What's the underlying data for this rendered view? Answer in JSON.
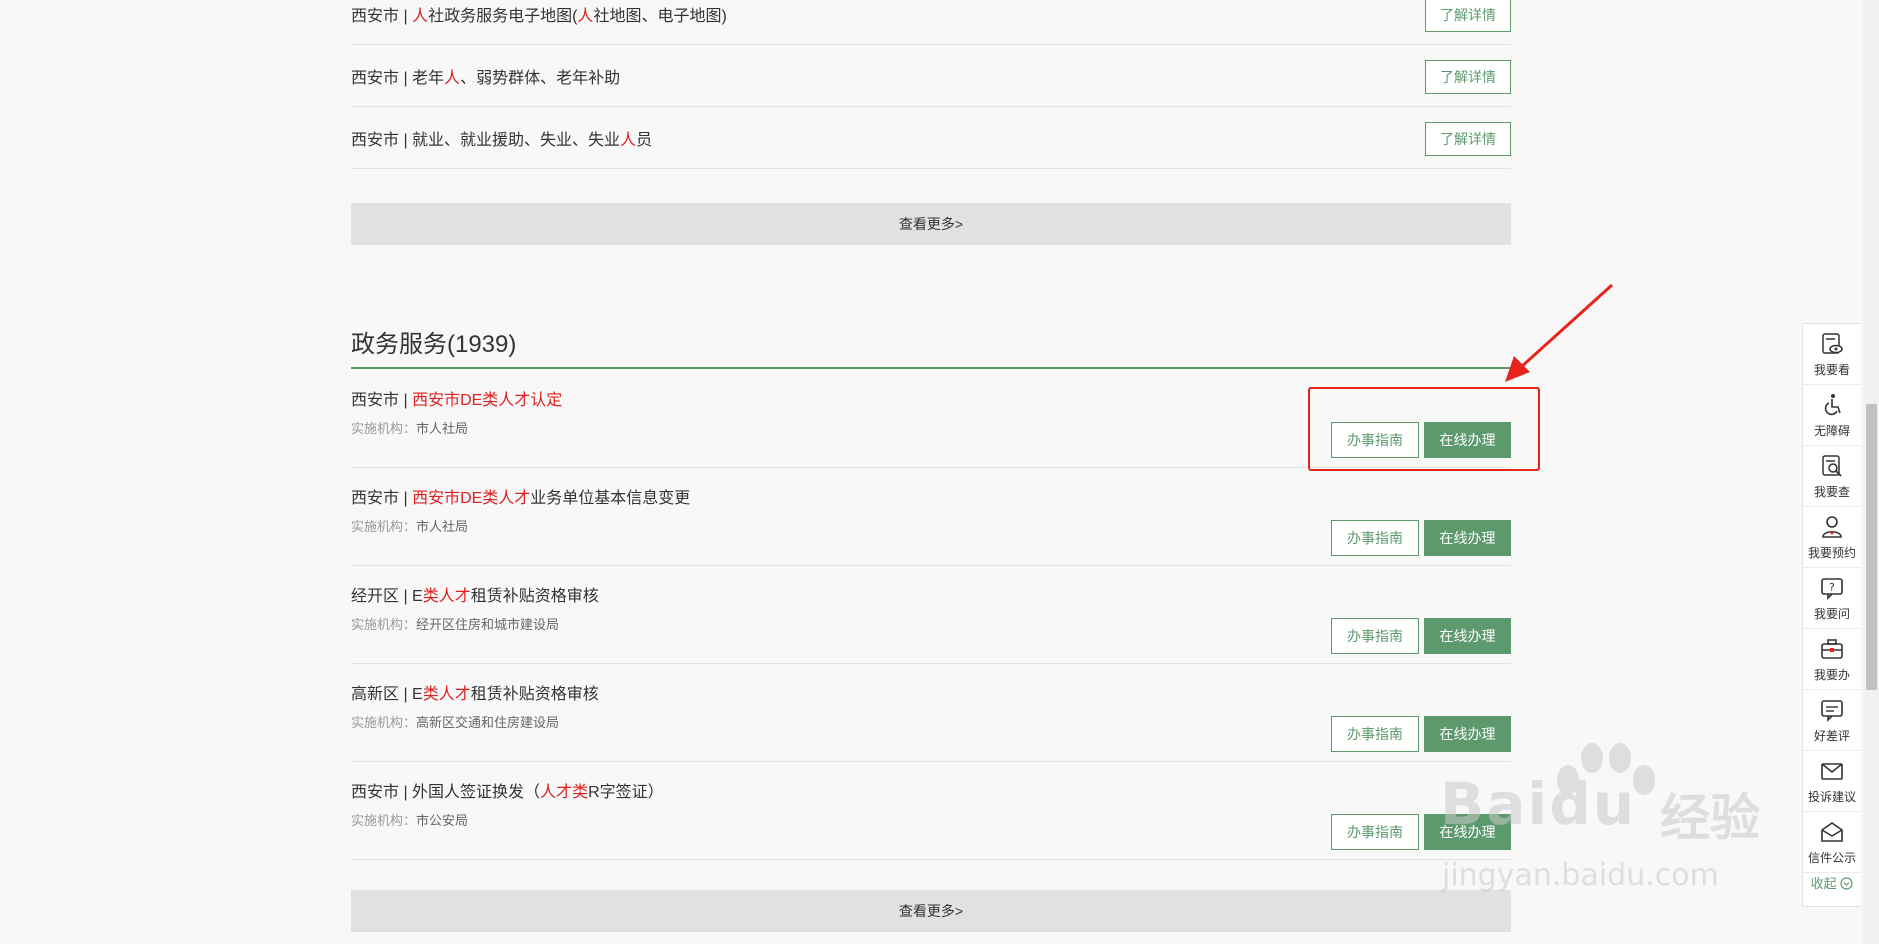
{
  "top_list": [
    {
      "title_parts": [
        {
          "t": "西安市 | ",
          "hl": false
        },
        {
          "t": "人",
          "hl": true
        },
        {
          "t": "社政务服务电子地图(",
          "hl": false
        },
        {
          "t": "人",
          "hl": true
        },
        {
          "t": "社地图、电子地图)",
          "hl": false
        }
      ],
      "button": "了解详情"
    },
    {
      "title_parts": [
        {
          "t": "西安市 | 老年",
          "hl": false
        },
        {
          "t": "人",
          "hl": true
        },
        {
          "t": "、弱势群体、老年补助",
          "hl": false
        }
      ],
      "button": "了解详情"
    },
    {
      "title_parts": [
        {
          "t": "西安市 | 就业、就业援助、失业、失业",
          "hl": false
        },
        {
          "t": "人",
          "hl": true
        },
        {
          "t": "员",
          "hl": false
        }
      ],
      "button": "了解详情"
    }
  ],
  "more_label": "查看更多>",
  "section": {
    "title": "政务服务(1939)"
  },
  "services": [
    {
      "title_parts": [
        {
          "t": "西安市 | ",
          "hl": false
        },
        {
          "t": "西安市DE类人才认定",
          "hl": true
        }
      ],
      "org_label": "实施机构：",
      "org": "市人社局",
      "guide": "办事指南",
      "online": "在线办理"
    },
    {
      "title_parts": [
        {
          "t": "西安市 | ",
          "hl": false
        },
        {
          "t": "西安市DE类人才",
          "hl": true
        },
        {
          "t": "业务单位基本信息变更",
          "hl": false
        }
      ],
      "org_label": "实施机构：",
      "org": "市人社局",
      "guide": "办事指南",
      "online": "在线办理"
    },
    {
      "title_parts": [
        {
          "t": "经开区 | E",
          "hl": false
        },
        {
          "t": "类人才",
          "hl": true
        },
        {
          "t": "租赁补贴资格审核",
          "hl": false
        }
      ],
      "org_label": "实施机构：",
      "org": "经开区住房和城市建设局",
      "guide": "办事指南",
      "online": "在线办理"
    },
    {
      "title_parts": [
        {
          "t": "高新区 | E",
          "hl": false
        },
        {
          "t": "类人才",
          "hl": true
        },
        {
          "t": "租赁补贴资格审核",
          "hl": false
        }
      ],
      "org_label": "实施机构：",
      "org": "高新区交通和住房建设局",
      "guide": "办事指南",
      "online": "在线办理"
    },
    {
      "title_parts": [
        {
          "t": "西安市 | 外国人签证换发（",
          "hl": false
        },
        {
          "t": "人才类",
          "hl": true
        },
        {
          "t": "R字签证）",
          "hl": false
        }
      ],
      "org_label": "实施机构：",
      "org": "市公安局",
      "guide": "办事指南",
      "online": "在线办理"
    }
  ],
  "sidebar": {
    "items": [
      {
        "label": "我要看",
        "icon": "eye-doc-icon"
      },
      {
        "label": "无障碍",
        "icon": "wheelchair-icon"
      },
      {
        "label": "我要查",
        "icon": "search-doc-icon"
      },
      {
        "label": "我要预约",
        "icon": "person-icon"
      },
      {
        "label": "我要问",
        "icon": "question-bubble-icon"
      },
      {
        "label": "我要办",
        "icon": "briefcase-icon"
      },
      {
        "label": "好差评",
        "icon": "comment-icon"
      },
      {
        "label": "投诉建议",
        "icon": "mail-icon"
      },
      {
        "label": "信件公示",
        "icon": "open-mail-icon"
      }
    ],
    "collapse_label": "收起"
  },
  "watermark": {
    "brand": "Baidu",
    "cn": "经验",
    "url": "jingyan.baidu.com"
  },
  "colors": {
    "accent": "#5c9a6e",
    "highlight": "#e02020",
    "annotation": "#e8231c"
  }
}
